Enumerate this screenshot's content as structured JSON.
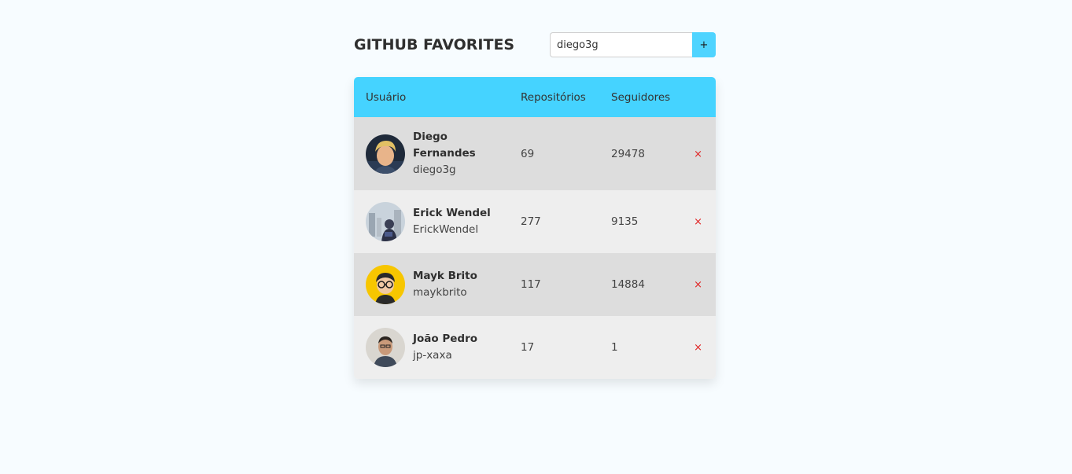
{
  "header": {
    "title": "GITHUB FAVORITES",
    "search_value": "diego3g",
    "search_placeholder": "",
    "add_button_label": "+"
  },
  "table": {
    "columns": [
      "Usuário",
      "Repositórios",
      "Seguidores"
    ],
    "rows": [
      {
        "name": "Diego Fernandes",
        "login": "diego3g",
        "repositories": "69",
        "followers": "29478",
        "avatar": "diego-avatar"
      },
      {
        "name": "Erick Wendel",
        "login": "ErickWendel",
        "repositories": "277",
        "followers": "9135",
        "avatar": "erick-avatar"
      },
      {
        "name": "Mayk Brito",
        "login": "maykbrito",
        "repositories": "117",
        "followers": "14884",
        "avatar": "mayk-avatar"
      },
      {
        "name": "João Pedro",
        "login": "jp-xaxa",
        "repositories": "17",
        "followers": "1",
        "avatar": "joao-avatar"
      }
    ],
    "remove_label": "×"
  },
  "colors": {
    "accent": "#45d3ff",
    "row_dark": "#dddddd",
    "row_light": "#eeeeee",
    "remove": "#e02424",
    "background": "#f7fcff"
  }
}
